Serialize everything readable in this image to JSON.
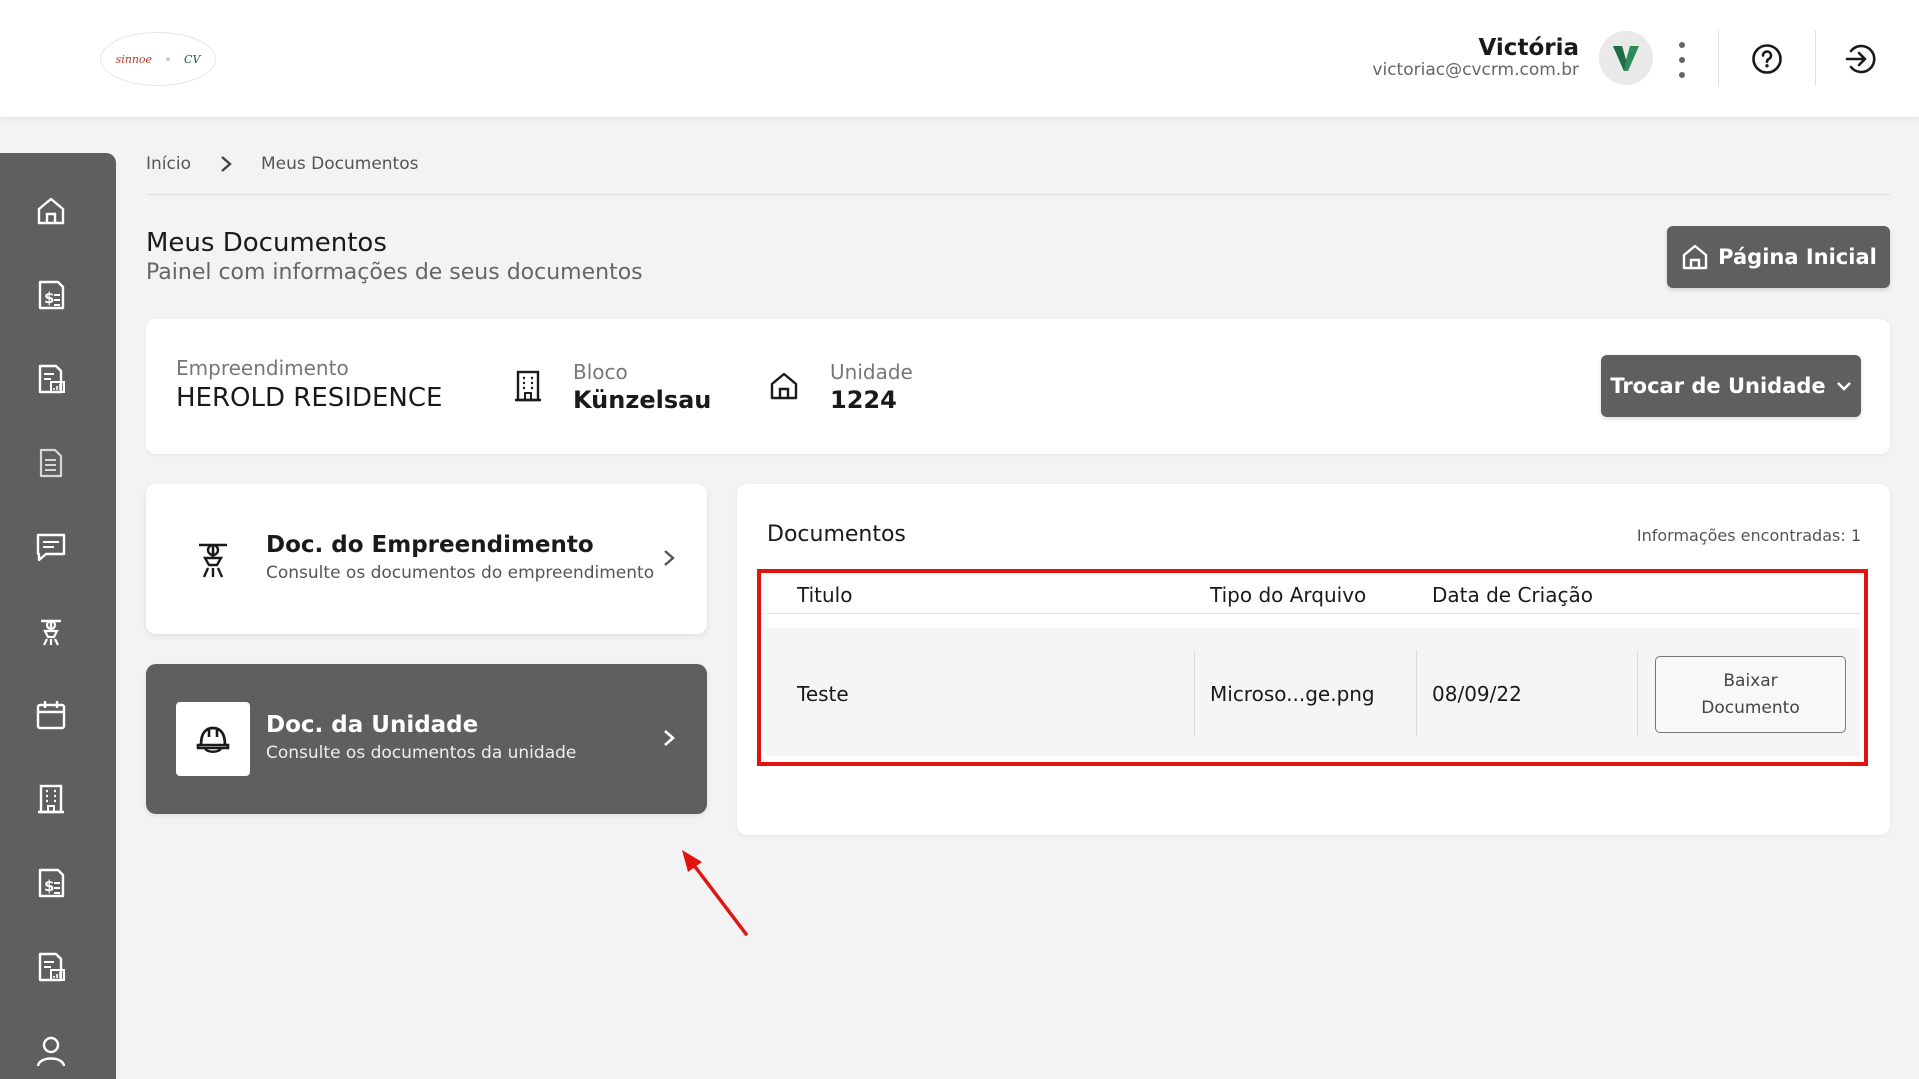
{
  "header": {
    "logo_left": "sinnoe",
    "logo_right": "CV",
    "user_name": "Victória",
    "user_email": "victoriac@cvcrm.com.br",
    "avatar_letter": "V",
    "avatar_color": "#2e8b57"
  },
  "breadcrumb": {
    "home": "Início",
    "current": "Meus Documentos"
  },
  "page": {
    "title": "Meus Documentos",
    "subtitle": "Painel com informações de seus documentos",
    "home_button": "Página Inicial"
  },
  "unit_info": {
    "empreendimento_label": "Empreendimento",
    "empreendimento_value": "HEROLD RESIDENCE",
    "bloco_label": "Bloco",
    "bloco_value": "Künzelsau",
    "unidade_label": "Unidade",
    "unidade_value": "1224",
    "switch_button": "Trocar de Unidade"
  },
  "doc_nav": [
    {
      "title": "Doc. do Empreendimento",
      "subtitle": "Consulte os documentos do empreendimento",
      "active": false
    },
    {
      "title": "Doc. da Unidade",
      "subtitle": "Consulte os documentos da unidade",
      "active": true
    }
  ],
  "documents": {
    "title": "Documentos",
    "count_text": "Informações encontradas: 1",
    "columns": [
      "Titulo",
      "Tipo do Arquivo",
      "Data de Criação"
    ],
    "rows": [
      {
        "titulo": "Teste",
        "tipo": "Microso...ge.png",
        "data": "08/09/22",
        "action": "Baixar Documento"
      }
    ]
  },
  "colors": {
    "sidebar": "#5f5f5f",
    "accent_dark": "#5f5f5f",
    "highlight": "#e11414"
  }
}
